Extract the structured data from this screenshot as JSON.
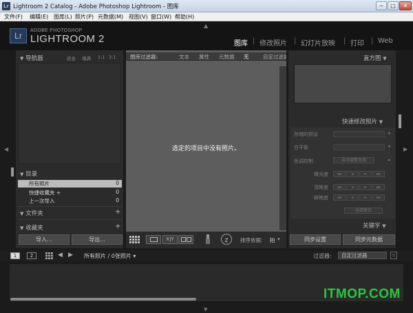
{
  "window": {
    "title": "Lightroom 2 Catalog - Adobe Photoshop Lightroom - 图库",
    "icon_text": "Lr",
    "controls": {
      "minimize": "─",
      "maximize": "□",
      "close": "✕"
    }
  },
  "menubar": [
    "文件(F)",
    "编辑(E)",
    "图库(L)",
    "照片(P)",
    "元数据(M)",
    "视图(V)",
    "窗口(W)",
    "帮助(H)"
  ],
  "identity": {
    "logo": "Lr",
    "small": "ADOBE PHOTOSHOP",
    "big": "LIGHTROOM 2"
  },
  "modules": [
    {
      "label": "图库",
      "active": true
    },
    {
      "label": "修改照片",
      "active": false
    },
    {
      "label": "幻灯片放映",
      "active": false
    },
    {
      "label": "打印",
      "active": false
    },
    {
      "label": "Web",
      "active": false
    }
  ],
  "left_panel": {
    "navigator": {
      "title": "导航器",
      "options": [
        "适合",
        "填满",
        "1:1",
        "3:1"
      ]
    },
    "catalog": {
      "title": "目录",
      "items": [
        {
          "label": "所有照片",
          "count": "0"
        },
        {
          "label": "快捷收藏夹 +",
          "count": "0"
        },
        {
          "label": "上一次导入",
          "count": "0"
        }
      ]
    },
    "folders_title": "文件夹",
    "collections_title": "收藏夹",
    "plus": "+",
    "import_button": "导入...",
    "export_button": "导出..."
  },
  "center": {
    "filter_bar": {
      "label": "图库过滤器:",
      "items": [
        "文本",
        "属性",
        "元数据",
        "无"
      ],
      "custom": "自定过滤器"
    },
    "empty_message": "选定的项目中没有照片。",
    "toolbar": {
      "sort_label": "排序依据:",
      "sort_value": "拍"
    }
  },
  "right_panel": {
    "histogram_title": "直方图",
    "quick_develop": {
      "title": "快速修改照片",
      "saved_preset": "存储的预设",
      "white_balance": "白平衡",
      "tone_control": "色调控制",
      "auto_tone": "自动调整色调",
      "exposure": "曝光度",
      "clarity": "清晰度",
      "vibrance": "鲜艳度",
      "reset": "全部复位",
      "stepper_glyphs": [
        "◂◂",
        "◂",
        "▸",
        "▸▸"
      ]
    },
    "keywords_title": "关键字",
    "sync_settings_button": "同步设置",
    "sync_metadata_button": "同步元数据"
  },
  "filmstrip": {
    "monitor_1": "1",
    "monitor_2": "2",
    "source": "所有照片 / 0张照片 ▾",
    "filter_label": "过滤器:",
    "filter_value": "自定过滤器"
  },
  "watermark": "ITMOP.COM",
  "colors": {
    "watermark": "#27c93c",
    "panel": "#2b2b2b",
    "center": "#5d5d5d"
  }
}
